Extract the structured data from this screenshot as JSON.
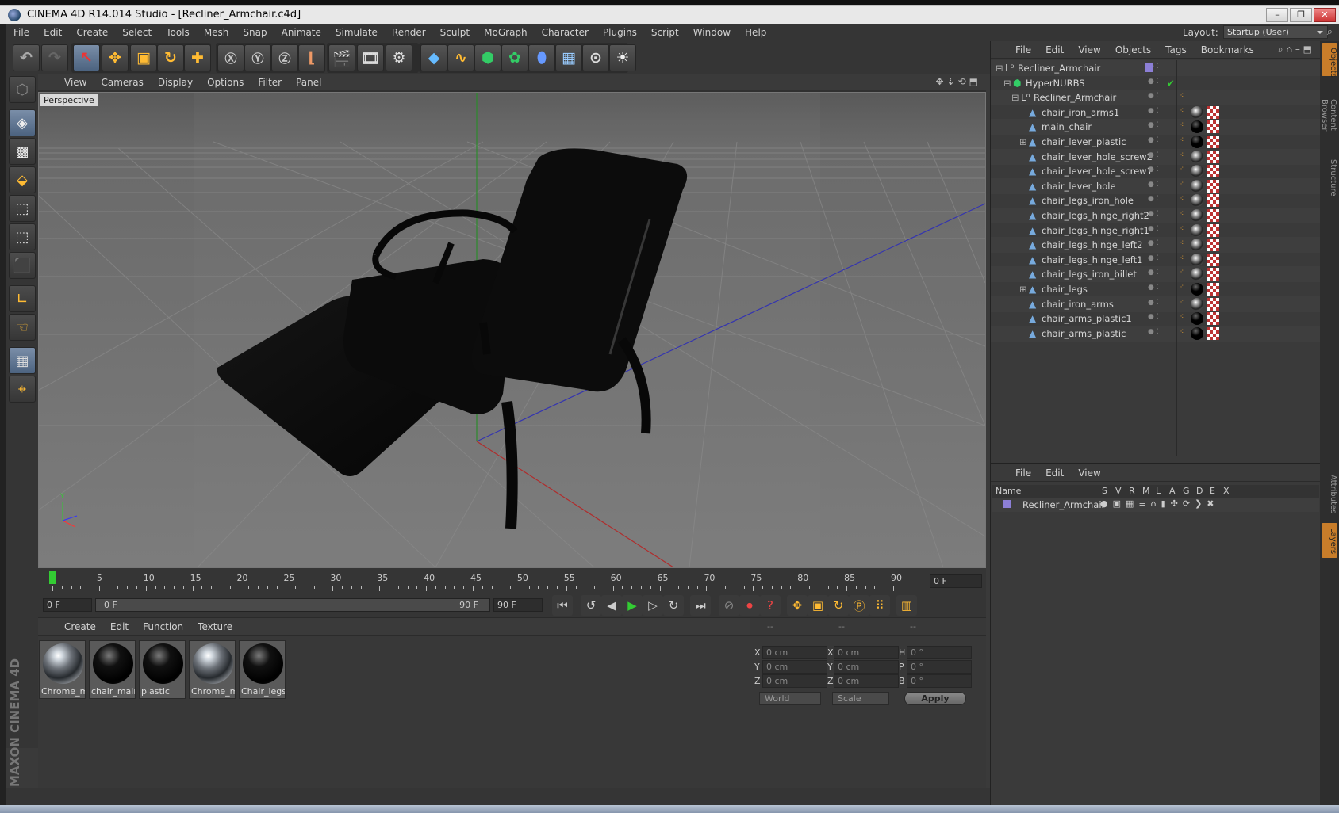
{
  "window": {
    "title": "CINEMA 4D R14.014 Studio - [Recliner_Armchair.c4d]",
    "minimize": "–",
    "restore": "❐",
    "close": "✕"
  },
  "menubar": {
    "items": [
      "File",
      "Edit",
      "Create",
      "Select",
      "Tools",
      "Mesh",
      "Snap",
      "Animate",
      "Simulate",
      "Render",
      "Sculpt",
      "MoGraph",
      "Character",
      "Plugins",
      "Script",
      "Window",
      "Help"
    ],
    "layout_label": "Layout:",
    "layout_value": "Startup (User)"
  },
  "viewport": {
    "menu": [
      "View",
      "Cameras",
      "Display",
      "Options",
      "Filter",
      "Panel"
    ],
    "label": "Perspective"
  },
  "timeline": {
    "ticks": [
      "0",
      "5",
      "10",
      "15",
      "20",
      "25",
      "30",
      "35",
      "40",
      "45",
      "50",
      "55",
      "60",
      "65",
      "70",
      "75",
      "80",
      "85",
      "90"
    ],
    "current_frame": "0 F"
  },
  "transport": {
    "start": "0 F",
    "range_start": "0 F",
    "range_end": "90 F",
    "end": "90 F"
  },
  "materials": {
    "menu": [
      "Create",
      "Edit",
      "Function",
      "Texture"
    ],
    "items": [
      {
        "name": "Chrome_mi",
        "kind": "chrome"
      },
      {
        "name": "chair_main",
        "kind": "black"
      },
      {
        "name": "plastic",
        "kind": "black"
      },
      {
        "name": "Chrome_mi",
        "kind": "chrome"
      },
      {
        "name": "Chair_legs",
        "kind": "black"
      }
    ]
  },
  "coordinates": {
    "headers": [
      "--",
      "--",
      "--"
    ],
    "rows": [
      {
        "l1": "X",
        "v1": "0 cm",
        "l2": "X",
        "v2": "0 cm",
        "l3": "H",
        "v3": "0 °"
      },
      {
        "l1": "Y",
        "v1": "0 cm",
        "l2": "Y",
        "v2": "0 cm",
        "l3": "P",
        "v3": "0 °"
      },
      {
        "l1": "Z",
        "v1": "0 cm",
        "l2": "Z",
        "v2": "0 cm",
        "l3": "B",
        "v3": "0 °"
      }
    ],
    "space": "World",
    "mode": "Scale",
    "apply": "Apply"
  },
  "objects": {
    "menu": [
      "File",
      "Edit",
      "View",
      "Objects",
      "Tags",
      "Bookmarks"
    ],
    "tree": [
      {
        "name": "Recliner_Armchair",
        "type": "null",
        "tags": "none"
      },
      {
        "name": "HyperNURBS",
        "type": "nurbs",
        "tags": "none"
      },
      {
        "name": "Recliner_Armchair",
        "type": "null",
        "tags": "phong"
      },
      {
        "name": "chair_iron_arms1",
        "type": "poly",
        "tags": "chrome"
      },
      {
        "name": "main_chair",
        "type": "poly",
        "tags": "black"
      },
      {
        "name": "chair_lever_plastic",
        "type": "poly",
        "tags": "black"
      },
      {
        "name": "chair_lever_hole_screw2",
        "type": "poly",
        "tags": "chrome"
      },
      {
        "name": "chair_lever_hole_screw1",
        "type": "poly",
        "tags": "chrome"
      },
      {
        "name": "chair_lever_hole",
        "type": "poly",
        "tags": "chrome"
      },
      {
        "name": "chair_legs_iron_hole",
        "type": "poly",
        "tags": "chrome"
      },
      {
        "name": "chair_legs_hinge_right2",
        "type": "poly",
        "tags": "chrome"
      },
      {
        "name": "chair_legs_hinge_right1",
        "type": "poly",
        "tags": "chrome"
      },
      {
        "name": "chair_legs_hinge_left2",
        "type": "poly",
        "tags": "chrome"
      },
      {
        "name": "chair_legs_hinge_left1",
        "type": "poly",
        "tags": "chrome"
      },
      {
        "name": "chair_legs_iron_billet",
        "type": "poly",
        "tags": "chrome"
      },
      {
        "name": "chair_legs",
        "type": "poly",
        "tags": "black"
      },
      {
        "name": "chair_iron_arms",
        "type": "poly",
        "tags": "chrome"
      },
      {
        "name": "chair_arms_plastic1",
        "type": "poly",
        "tags": "black"
      },
      {
        "name": "chair_arms_plastic",
        "type": "poly",
        "tags": "black"
      }
    ]
  },
  "layers": {
    "menu": [
      "File",
      "Edit",
      "View"
    ],
    "columns": [
      "Name",
      "S",
      "V",
      "R",
      "M",
      "L",
      "A",
      "G",
      "D",
      "E",
      "X"
    ],
    "rows": [
      {
        "name": "Recliner_Armchair",
        "color": "#8c7fd6"
      }
    ]
  },
  "sidetabs": [
    "Objects",
    "Content Browser",
    "Structure",
    "Attributes",
    "Layers"
  ],
  "brand": "MAXON CINEMA 4D"
}
